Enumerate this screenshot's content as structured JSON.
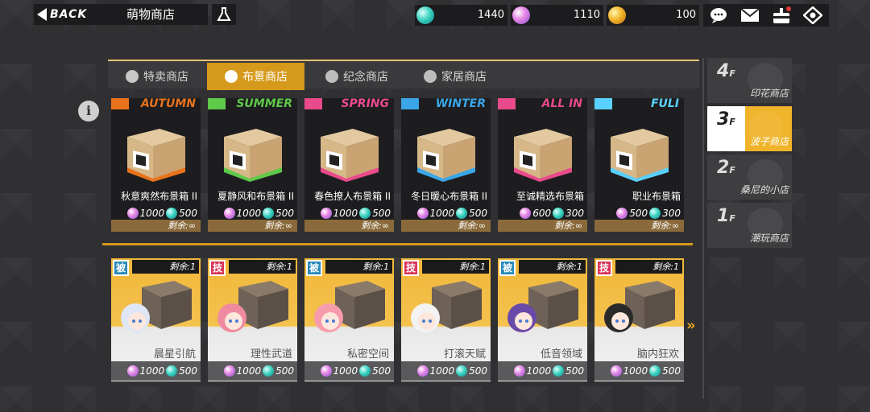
{
  "header": {
    "back_label": "BACK",
    "title": "萌物商店",
    "currencies": [
      {
        "icon": "teal-gem-icon",
        "value": "1440"
      },
      {
        "icon": "pink-gem-icon",
        "value": "1110"
      },
      {
        "icon": "gold-coin-icon",
        "value": "100"
      }
    ],
    "icons": [
      "chat-icon",
      "mail-icon",
      "cake-icon",
      "eye-icon"
    ]
  },
  "tabs": [
    {
      "label": "特卖商店",
      "active": false
    },
    {
      "label": "布景商店",
      "active": true
    },
    {
      "label": "纪念商店",
      "active": false
    },
    {
      "label": "家居商店",
      "active": false
    }
  ],
  "boxes": [
    {
      "season": "AUTUMN",
      "color": "#e8731c",
      "name": "秋意爽然布景箱 II",
      "price1": "1000",
      "price2": "500",
      "remain": "剩余:∞"
    },
    {
      "season": "SUMMER",
      "color": "#5fc94a",
      "name": "夏静风和布景箱 II",
      "price1": "1000",
      "price2": "500",
      "remain": "剩余:∞"
    },
    {
      "season": "SPRING",
      "color": "#e84a8c",
      "name": "春色撩人布景箱 II",
      "price1": "1000",
      "price2": "500",
      "remain": "剩余:∞"
    },
    {
      "season": "WINTER",
      "color": "#3aa6e8",
      "name": "冬日暖心布景箱 II",
      "price1": "1000",
      "price2": "500",
      "remain": "剩余:∞"
    },
    {
      "season": "ALL IN",
      "color": "#e84a8c",
      "name": "至诚精选布景箱",
      "price1": "600",
      "price2": "300",
      "remain": "剩余:∞"
    },
    {
      "season": "FULI",
      "color": "#5ad0ff",
      "name": "职业布景箱",
      "price1": "500",
      "price2": "300",
      "remain": "剩余:∞"
    }
  ],
  "characters": [
    {
      "type": "被",
      "kind": "passive",
      "remain": "剩余:1",
      "name": "晨星引航",
      "price1": "1000",
      "price2": "500"
    },
    {
      "type": "技",
      "kind": "skill",
      "remain": "剩余:1",
      "name": "理性武道",
      "price1": "1000",
      "price2": "500"
    },
    {
      "type": "被",
      "kind": "passive",
      "remain": "剩余:1",
      "name": "私密空间",
      "price1": "1000",
      "price2": "500"
    },
    {
      "type": "技",
      "kind": "skill",
      "remain": "剩余:1",
      "name": "打滚天赋",
      "price1": "1000",
      "price2": "500"
    },
    {
      "type": "被",
      "kind": "passive",
      "remain": "剩余:1",
      "name": "低音领域",
      "price1": "1000",
      "price2": "500"
    },
    {
      "type": "技",
      "kind": "skill",
      "remain": "剩余:1",
      "name": "脑内狂欢",
      "price1": "1000",
      "price2": "500"
    }
  ],
  "more_arrow": "»",
  "floors": [
    {
      "num": "4",
      "suffix": "F",
      "name": "印花商店",
      "active": false
    },
    {
      "num": "3",
      "suffix": "F",
      "name": "波子商店",
      "active": true
    },
    {
      "num": "2",
      "suffix": "F",
      "name": "桑尼的小店",
      "active": false
    },
    {
      "num": "1",
      "suffix": "F",
      "name": "潮玩商店",
      "active": false
    }
  ],
  "info_label": "i"
}
